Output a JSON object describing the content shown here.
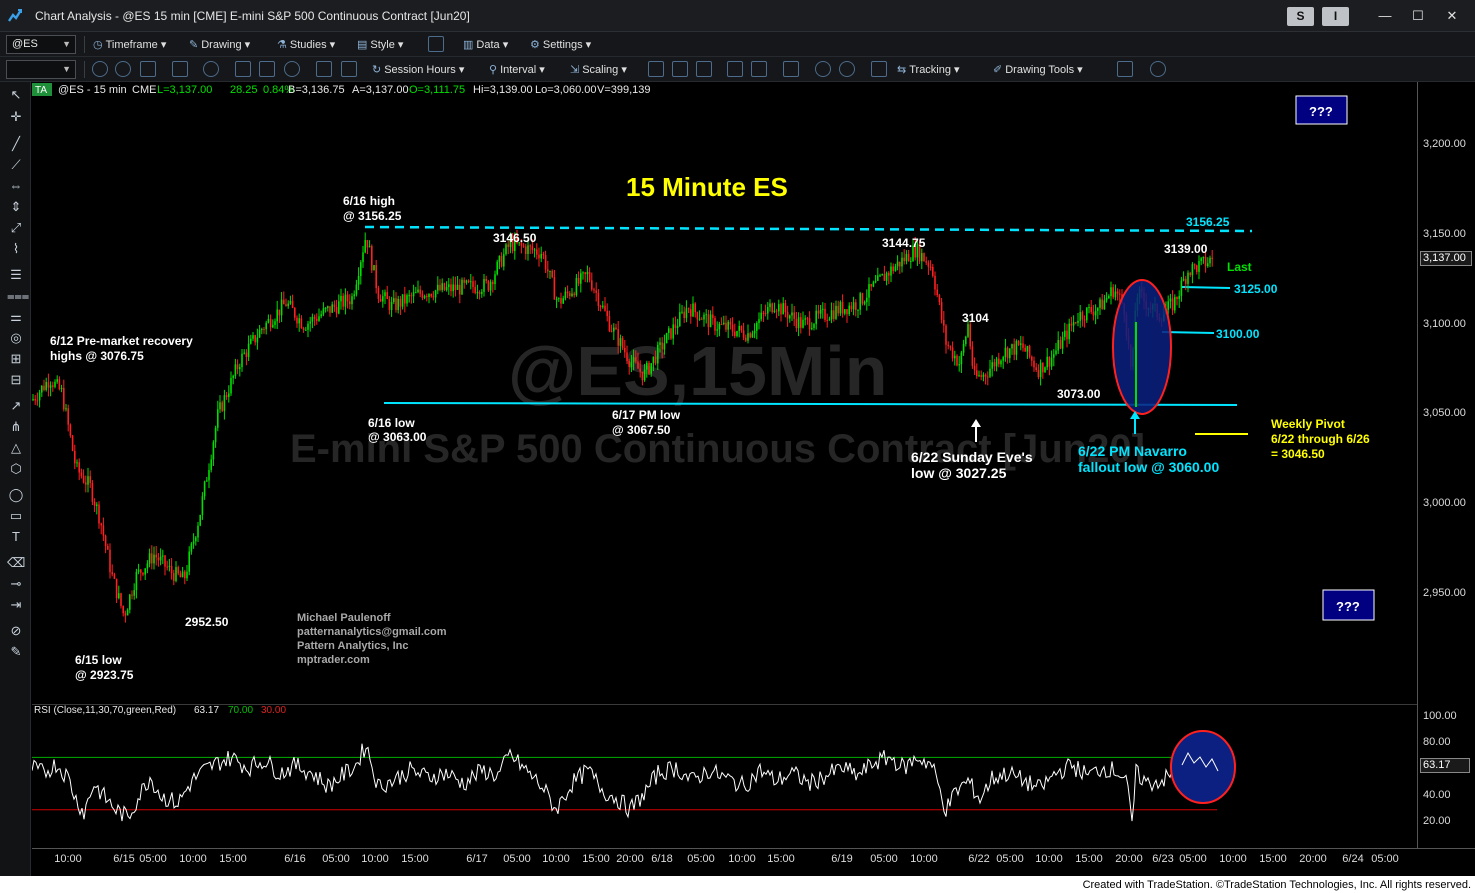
{
  "window": {
    "title": "Chart Analysis - @ES 15 min [CME] E-mini S&P 500 Continuous Contract [Jun20]",
    "chip_s": "S",
    "chip_i": "I",
    "minimize": "—",
    "maximize": "☐",
    "close": "✕"
  },
  "toolbar1": {
    "symbol": "@ES",
    "timeframe": "Timeframe",
    "drawing": "Drawing",
    "studies": "Studies",
    "style": "Style",
    "data": "Data",
    "settings": "Settings"
  },
  "toolbar2": {
    "session_hours": "Session Hours",
    "interval": "Interval",
    "scaling": "Scaling",
    "tracking": "Tracking",
    "drawing_tools": "Drawing Tools"
  },
  "status_line": {
    "badge": "TA",
    "symbol": "@ES - 15 min",
    "exchange": "CME",
    "last": "L=3,137.00",
    "change": "28.25",
    "pct": "0.84%",
    "bid": "B=3,136.75",
    "ask": "A=3,137.00",
    "open": "O=3,111.75",
    "high": "Hi=3,139.00",
    "low": "Lo=3,060.00",
    "volume": "V=399,139"
  },
  "watermark": {
    "line1": "@ES,15Min",
    "line2": "E-mini S&P 500 Continuous Contract [Jun20]"
  },
  "chart_data": {
    "type": "candlestick",
    "title": "15 Minute ES",
    "ylim": [
      2890,
      3235
    ],
    "yticks": [
      2950,
      3000,
      3050,
      3100,
      3150,
      3200
    ],
    "ytick_labels": [
      "2,950.00",
      "3,000.00",
      "3,050.00",
      "3,100.00",
      "3,150.00",
      "3,200.00"
    ],
    "last_price": "3,137.00",
    "price_path_approx": [
      [
        0,
        3058
      ],
      [
        18,
        3070
      ],
      [
        30,
        3062
      ],
      [
        44,
        3020
      ],
      [
        58,
        3010
      ],
      [
        68,
        2992
      ],
      [
        80,
        2960
      ],
      [
        92,
        2938
      ],
      [
        104,
        2960
      ],
      [
        122,
        2972
      ],
      [
        140,
        2962
      ],
      [
        152,
        2958
      ],
      [
        168,
        2995
      ],
      [
        186,
        3050
      ],
      [
        208,
        3080
      ],
      [
        230,
        3098
      ],
      [
        254,
        3112
      ],
      [
        272,
        3100
      ],
      [
        296,
        3108
      ],
      [
        320,
        3115
      ],
      [
        334,
        3150
      ],
      [
        346,
        3118
      ],
      [
        360,
        3110
      ],
      [
        390,
        3118
      ],
      [
        420,
        3120
      ],
      [
        456,
        3122
      ],
      [
        478,
        3145
      ],
      [
        510,
        3140
      ],
      [
        526,
        3112
      ],
      [
        556,
        3128
      ],
      [
        578,
        3100
      ],
      [
        598,
        3080
      ],
      [
        612,
        3072
      ],
      [
        632,
        3090
      ],
      [
        656,
        3110
      ],
      [
        682,
        3100
      ],
      [
        716,
        3095
      ],
      [
        742,
        3112
      ],
      [
        770,
        3100
      ],
      [
        804,
        3108
      ],
      [
        826,
        3112
      ],
      [
        858,
        3130
      ],
      [
        884,
        3142
      ],
      [
        900,
        3132
      ],
      [
        914,
        3090
      ],
      [
        928,
        3078
      ],
      [
        936,
        3100
      ],
      [
        942,
        3070
      ],
      [
        952,
        3072
      ],
      [
        972,
        3085
      ],
      [
        990,
        3088
      ],
      [
        1006,
        3075
      ],
      [
        1020,
        3082
      ],
      [
        1046,
        3105
      ],
      [
        1068,
        3110
      ],
      [
        1082,
        3120
      ],
      [
        1092,
        3110
      ],
      [
        1100,
        3070
      ],
      [
        1104,
        3118
      ],
      [
        1118,
        3110
      ],
      [
        1128,
        3105
      ],
      [
        1142,
        3112
      ],
      [
        1156,
        3130
      ],
      [
        1172,
        3134
      ],
      [
        1182,
        3137
      ]
    ],
    "rsi": {
      "label": "RSI (Close,11,30,70,green,Red)",
      "value": "63.17",
      "overbought": "70.00",
      "oversold": "30.00",
      "ylim": [
        0,
        110
      ],
      "yticks": [
        20,
        40,
        60,
        80,
        100
      ],
      "ytick_labels": [
        "20.00",
        "40.00",
        "60.00",
        "80.00",
        "100.00"
      ],
      "last_label": "63.17",
      "path_approx": [
        [
          0,
          62
        ],
        [
          12,
          58
        ],
        [
          24,
          65
        ],
        [
          36,
          55
        ],
        [
          44,
          38
        ],
        [
          52,
          28
        ],
        [
          62,
          50
        ],
        [
          72,
          40
        ],
        [
          84,
          30
        ],
        [
          96,
          24
        ],
        [
          108,
          42
        ],
        [
          118,
          55
        ],
        [
          130,
          40
        ],
        [
          146,
          35
        ],
        [
          160,
          52
        ],
        [
          172,
          60
        ],
        [
          186,
          66
        ],
        [
          200,
          70
        ],
        [
          216,
          62
        ],
        [
          232,
          68
        ],
        [
          248,
          58
        ],
        [
          264,
          64
        ],
        [
          280,
          58
        ],
        [
          296,
          48
        ],
        [
          310,
          56
        ],
        [
          324,
          64
        ],
        [
          334,
          80
        ],
        [
          346,
          48
        ],
        [
          360,
          52
        ],
        [
          378,
          60
        ],
        [
          396,
          55
        ],
        [
          414,
          58
        ],
        [
          432,
          50
        ],
        [
          450,
          60
        ],
        [
          466,
          56
        ],
        [
          478,
          72
        ],
        [
          494,
          60
        ],
        [
          510,
          48
        ],
        [
          524,
          30
        ],
        [
          540,
          50
        ],
        [
          556,
          60
        ],
        [
          572,
          44
        ],
        [
          586,
          38
        ],
        [
          598,
          30
        ],
        [
          612,
          42
        ],
        [
          626,
          58
        ],
        [
          644,
          62
        ],
        [
          660,
          52
        ],
        [
          676,
          60
        ],
        [
          694,
          54
        ],
        [
          712,
          48
        ],
        [
          728,
          60
        ],
        [
          744,
          52
        ],
        [
          760,
          58
        ],
        [
          778,
          50
        ],
        [
          794,
          56
        ],
        [
          810,
          62
        ],
        [
          826,
          56
        ],
        [
          842,
          66
        ],
        [
          858,
          70
        ],
        [
          872,
          62
        ],
        [
          886,
          70
        ],
        [
          900,
          64
        ],
        [
          914,
          30
        ],
        [
          924,
          44
        ],
        [
          936,
          52
        ],
        [
          948,
          38
        ],
        [
          960,
          54
        ],
        [
          976,
          58
        ],
        [
          992,
          52
        ],
        [
          1008,
          46
        ],
        [
          1024,
          58
        ],
        [
          1040,
          64
        ],
        [
          1056,
          56
        ],
        [
          1070,
          62
        ],
        [
          1084,
          60
        ],
        [
          1094,
          54
        ],
        [
          1100,
          18
        ],
        [
          1104,
          58
        ],
        [
          1116,
          50
        ],
        [
          1128,
          52
        ],
        [
          1140,
          56
        ],
        [
          1152,
          66
        ],
        [
          1166,
          68
        ],
        [
          1182,
          63
        ]
      ]
    },
    "time_axis_labels": [
      "10:00",
      "6/15",
      "05:00",
      "10:00",
      "15:00",
      "6/16",
      "05:00",
      "10:00",
      "15:00",
      "6/17",
      "05:00",
      "10:00",
      "15:00",
      "20:00",
      "6/18",
      "05:00",
      "10:00",
      "15:00",
      "6/19",
      "05:00",
      "10:00",
      "6/22",
      "05:00",
      "10:00",
      "15:00",
      "20:00",
      "6/23",
      "05:00",
      "10:00",
      "15:00",
      "20:00",
      "6/24",
      "05:00"
    ]
  },
  "annotations": {
    "a_612": {
      "l1": "6/12 Pre-market recovery",
      "l2": "highs @ 3076.75"
    },
    "a_615": {
      "l1": "6/15 low",
      "l2": "@ 2923.75"
    },
    "a_2952": "2952.50",
    "a_616h": {
      "l1": "6/16 high",
      "l2": "@ 3156.25"
    },
    "a_616l": {
      "l1": "6/16 low",
      "l2": "@ 3063.00"
    },
    "a_3146": "3146.50",
    "a_617": {
      "l1": "6/17 PM low",
      "l2": "@ 3067.50"
    },
    "a_3144": "3144.75",
    "a_3104": "3104",
    "a_3073": "3073.00",
    "a_622s": {
      "l1": "6/22 Sunday Eve's",
      "l2": "low @ 3027.25"
    },
    "a_622n": {
      "l1": "6/22 PM Navarro",
      "l2": "fallout low @ 3060.00"
    },
    "a_3139": "3139.00",
    "a_3156": "3156.25",
    "a_last": "Last",
    "a_3125": "3125.00",
    "a_3100": "3100.00",
    "pivot": {
      "l1": "Weekly Pivot",
      "l2": "6/22 through 6/26",
      "l3": "= 3046.50"
    },
    "qq1": "???",
    "qq2": "???",
    "credit": {
      "l1": "Michael Paulenoff",
      "l2": "patternanalytics@gmail.com",
      "l3": "Pattern Analytics, Inc",
      "l4": "mptrader.com"
    }
  },
  "colors": {
    "up": "#00e000",
    "down": "#ff2020",
    "cyan": "#00e5ff",
    "yellow": "#ffff00",
    "rsi_line": "#ffffff",
    "rsi_over": "#ff3030",
    "rsi_green": "#00b000",
    "rsi_red": "#d00000",
    "ellipse_fill": "#0b2080",
    "ellipse_stroke": "#ff2020",
    "box_fill": "#000080"
  },
  "footer": "Created with TradeStation. ©TradeStation Technologies, Inc. All rights reserved."
}
